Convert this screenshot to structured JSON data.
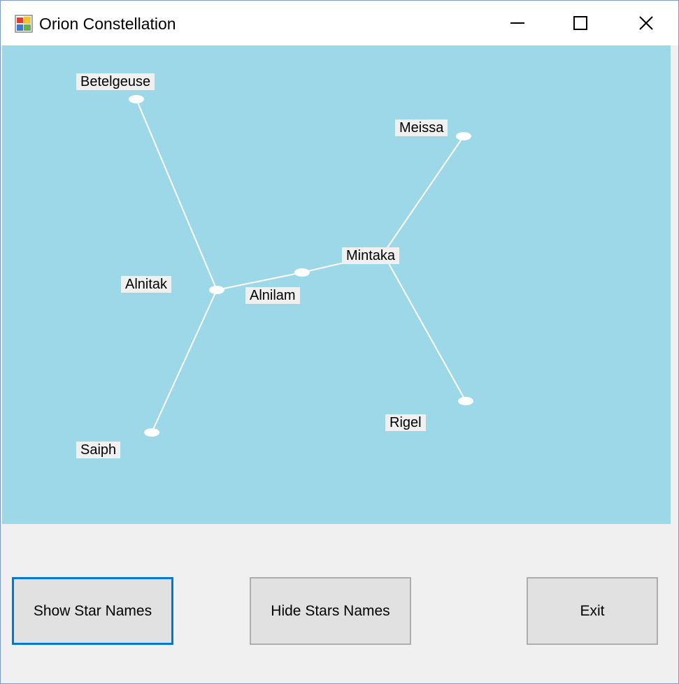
{
  "window": {
    "title": "Orion Constellation"
  },
  "stars": {
    "betelgeuse": "Betelgeuse",
    "meissa": "Meissa",
    "mintaka": "Mintaka",
    "alnitak": "Alnitak",
    "alnilam": "Alnilam",
    "rigel": "Rigel",
    "saiph": "Saiph"
  },
  "buttons": {
    "show": "Show Star Names",
    "hide": "Hide Stars Names",
    "exit": "Exit"
  },
  "colors": {
    "sky": "#9cd8e8",
    "star": "#ffffff",
    "line": "#ffffff",
    "focus": "#0078d7"
  },
  "icons": {
    "app": "app-form-icon",
    "minimize": "minimize-icon",
    "maximize": "maximize-icon",
    "close": "close-icon"
  }
}
